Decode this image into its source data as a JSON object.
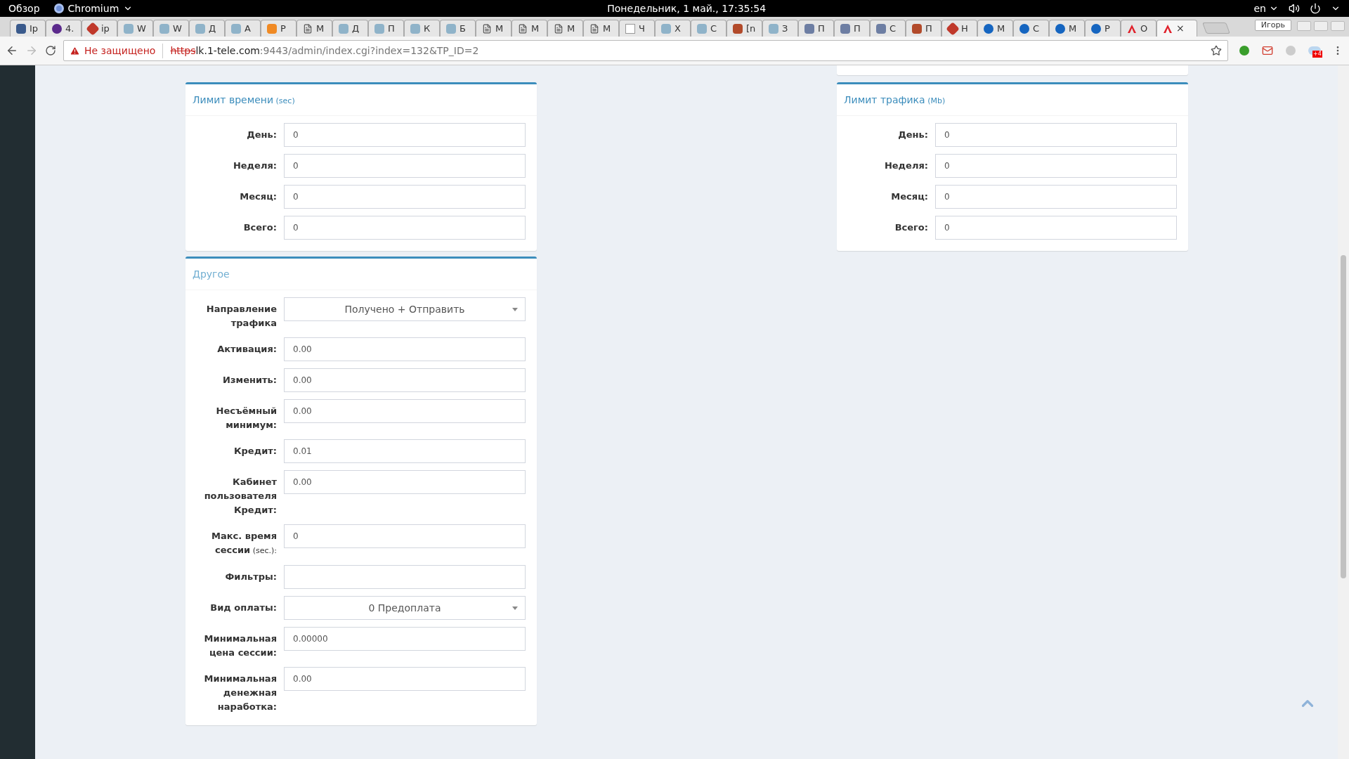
{
  "system_bar": {
    "activities": "Обзор",
    "app": "Chromium",
    "clock": "Понедельник, 1 май., 17:35:54",
    "language": "en"
  },
  "tabs": [
    {
      "title": "Ip",
      "kind": "orb-stripes",
      "selected": false
    },
    {
      "title": "4.",
      "kind": "orb",
      "selected": false
    },
    {
      "title": "ip",
      "kind": "pencil",
      "selected": false
    },
    {
      "title": "W",
      "kind": "h",
      "selected": false
    },
    {
      "title": "W",
      "kind": "h",
      "selected": false
    },
    {
      "title": "Д",
      "kind": "h",
      "selected": false
    },
    {
      "title": "А",
      "kind": "h",
      "selected": false
    },
    {
      "title": "Р",
      "kind": "rss",
      "selected": false
    },
    {
      "title": "М",
      "kind": "doc",
      "selected": false
    },
    {
      "title": "Д",
      "kind": "h",
      "selected": false
    },
    {
      "title": "П",
      "kind": "h",
      "selected": false
    },
    {
      "title": "К",
      "kind": "h",
      "selected": false
    },
    {
      "title": "Б",
      "kind": "h",
      "selected": false
    },
    {
      "title": "М",
      "kind": "doc",
      "selected": false
    },
    {
      "title": "М",
      "kind": "doc",
      "selected": false
    },
    {
      "title": "М",
      "kind": "doc",
      "selected": false
    },
    {
      "title": "М",
      "kind": "doc",
      "selected": false
    },
    {
      "title": "Ч",
      "kind": "w",
      "selected": false
    },
    {
      "title": "Х",
      "kind": "h",
      "selected": false
    },
    {
      "title": "С",
      "kind": "h",
      "selected": false
    },
    {
      "title": "[n",
      "kind": "figure",
      "selected": false
    },
    {
      "title": "З",
      "kind": "h",
      "selected": false
    },
    {
      "title": "П",
      "kind": "gt",
      "selected": false
    },
    {
      "title": "П",
      "kind": "gt",
      "selected": false
    },
    {
      "title": "С",
      "kind": "gt",
      "selected": false
    },
    {
      "title": "П",
      "kind": "figure",
      "selected": false
    },
    {
      "title": "Н",
      "kind": "pencil",
      "selected": false
    },
    {
      "title": "М",
      "kind": "nag",
      "selected": false
    },
    {
      "title": "С",
      "kind": "nag",
      "selected": false
    },
    {
      "title": "М",
      "kind": "nag",
      "selected": false
    },
    {
      "title": "Р",
      "kind": "nag",
      "selected": false
    },
    {
      "title": "О",
      "kind": "a",
      "selected": false
    },
    {
      "close": "×",
      "kind": "a",
      "selected": true
    }
  ],
  "profile": "Игорь",
  "address": {
    "warning": "Не защищено",
    "scheme": "https",
    "host": "lk.1-tele.com",
    "rest": ":9443/admin/index.cgi?index=132&TP_ID=2"
  },
  "extension_badge": "+4",
  "left_column": [
    {
      "title": "Лимит времени",
      "unit": "(sec)",
      "rows": [
        {
          "label": "День:",
          "value": "0",
          "kind": "input"
        },
        {
          "label": "Неделя:",
          "value": "0",
          "kind": "input"
        },
        {
          "label": "Месяц:",
          "value": "0",
          "kind": "input"
        },
        {
          "label": "Всего:",
          "value": "0",
          "kind": "input"
        }
      ]
    },
    {
      "title": "Другое",
      "rows": [
        {
          "label": "Направление трафика",
          "value": "Получено + Отправить",
          "kind": "select"
        },
        {
          "label": "Активация:",
          "value": "0.00",
          "kind": "input"
        },
        {
          "label": "Изменить:",
          "value": "0.00",
          "kind": "input"
        },
        {
          "label": "Несъёмный минимум:",
          "value": "0.00",
          "kind": "input"
        },
        {
          "label": "Кредит:",
          "value": "0.01",
          "kind": "input"
        },
        {
          "label": "Кабинет пользователя Кредит:",
          "value": "0.00",
          "kind": "input"
        },
        {
          "label": "Макс. время сессии",
          "unit": "(sec.):",
          "value": "0",
          "kind": "input"
        },
        {
          "label": "Фильтры:",
          "value": "",
          "kind": "input"
        },
        {
          "label": "Вид оплаты:",
          "value": "0 Предоплата",
          "kind": "select"
        },
        {
          "label": "Минимальная цена сессии:",
          "value": "0.00000",
          "kind": "input"
        },
        {
          "label": "Минимальная денежная наработка:",
          "value": "0.00",
          "kind": "input"
        }
      ]
    }
  ],
  "right_column": [
    {
      "title": "Лимит трафика",
      "unit": "(Mb)",
      "rows": [
        {
          "label": "День:",
          "value": "0",
          "kind": "input"
        },
        {
          "label": "Неделя:",
          "value": "0",
          "kind": "input"
        },
        {
          "label": "Месяц:",
          "value": "0",
          "kind": "input"
        },
        {
          "label": "Всего:",
          "value": "0",
          "kind": "input"
        }
      ]
    }
  ]
}
